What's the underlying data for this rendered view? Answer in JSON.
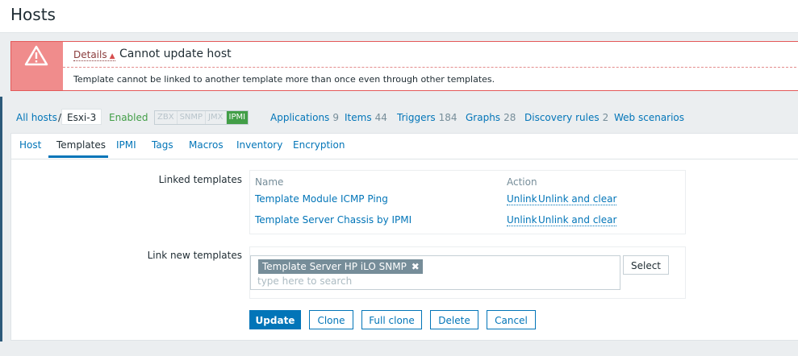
{
  "header": {
    "title": "Hosts"
  },
  "error": {
    "details_label": "Details",
    "details_arrow": "▲",
    "title": "Cannot update host",
    "message": "Template cannot be linked to another template more than once even through other templates."
  },
  "nav": {
    "all_hosts": "All hosts",
    "separator": "/",
    "host_name": "Esxi-3",
    "status": "Enabled",
    "availability": [
      {
        "label": "ZBX",
        "active": false
      },
      {
        "label": "SNMP",
        "active": false
      },
      {
        "label": "JMX",
        "active": false
      },
      {
        "label": "IPMI",
        "active": true
      }
    ],
    "links": [
      {
        "label": "Applications",
        "count": "9"
      },
      {
        "label": "Items",
        "count": "44"
      },
      {
        "label": "Triggers",
        "count": "184"
      },
      {
        "label": "Graphs",
        "count": "28"
      },
      {
        "label": "Discovery rules",
        "count": "2"
      },
      {
        "label": "Web scenarios",
        "count": ""
      }
    ]
  },
  "tabs": [
    {
      "label": "Host"
    },
    {
      "label": "Templates",
      "active": true
    },
    {
      "label": "IPMI"
    },
    {
      "label": "Tags"
    },
    {
      "label": "Macros"
    },
    {
      "label": "Inventory"
    },
    {
      "label": "Encryption"
    }
  ],
  "linked_templates": {
    "label": "Linked templates",
    "col_name": "Name",
    "col_action": "Action",
    "rows": [
      {
        "name": "Template Module ICMP Ping",
        "unlink": "Unlink",
        "unlink_clear": "Unlink and clear"
      },
      {
        "name": "Template Server Chassis by IPMI",
        "unlink": "Unlink",
        "unlink_clear": "Unlink and clear"
      }
    ]
  },
  "link_new": {
    "label": "Link new templates",
    "selected_chip": "Template Server HP iLO SNMP",
    "chip_remove": "✖",
    "placeholder": "type here to search",
    "select_button": "Select"
  },
  "actions": {
    "update": "Update",
    "clone": "Clone",
    "full_clone": "Full clone",
    "delete": "Delete",
    "cancel": "Cancel"
  },
  "colors": {
    "accent": "#0275b8",
    "error_border": "#e45959",
    "error_icon_bg": "#f08c8c",
    "enabled": "#429e47",
    "chip_bg": "#768d99"
  },
  "icons": {
    "error": "warning-triangle-icon",
    "chip_remove": "close-icon"
  }
}
